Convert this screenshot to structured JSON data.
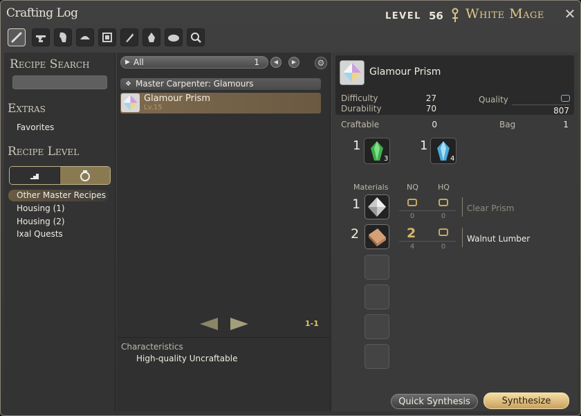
{
  "window": {
    "title": "Crafting Log",
    "level_label": "LEVEL",
    "level_value": "56",
    "job": "White Mage"
  },
  "toolbar": {
    "icons": [
      "carpenter-icon",
      "blacksmith-icon",
      "armorer-icon",
      "goldsmith-icon",
      "leatherworker-icon",
      "weaver-icon",
      "alchemist-icon",
      "culinarian-icon",
      "search-icon"
    ],
    "active_index": 0
  },
  "sidebar": {
    "recipe_search_heading": "Recipe Search",
    "extras_heading": "Extras",
    "favorites": "Favorites",
    "recipe_level_heading": "Recipe Level",
    "categories": [
      {
        "label": "Other Master Recipes",
        "selected": true
      },
      {
        "label": "Housing (1)",
        "selected": false
      },
      {
        "label": "Housing (2)",
        "selected": false
      },
      {
        "label": "Ixal Quests",
        "selected": false
      }
    ]
  },
  "list": {
    "filter_label": "All",
    "filter_count": "1",
    "group": "Master Carpenter: Glamours",
    "recipe": {
      "name": "Glamour Prism",
      "level": "Lv.15"
    },
    "page": "1-1",
    "characteristics_heading": "Characteristics",
    "characteristics_value": "High-quality Uncraftable"
  },
  "detail": {
    "name": "Glamour Prism",
    "difficulty_label": "Difficulty",
    "difficulty": "27",
    "durability_label": "Durability",
    "durability": "70",
    "quality_label": "Quality",
    "quality": "807",
    "craftable_label": "Craftable",
    "craftable": "0",
    "bag_label": "Bag",
    "bag": "1",
    "crystals": [
      {
        "qty": "1",
        "count": "3",
        "color": "#3fae4c"
      },
      {
        "qty": "1",
        "count": "4",
        "color": "#4aa8d8"
      }
    ],
    "materials_heading": "Materials",
    "nq_heading": "NQ",
    "hq_heading": "HQ",
    "materials": [
      {
        "qty": "1",
        "nq_need": "",
        "hq_need": "",
        "nq_have": "0",
        "hq_have": "0",
        "name": "Clear Prism",
        "name_color": "#8f8a7d"
      },
      {
        "qty": "2",
        "nq_need": "2",
        "hq_need": "",
        "nq_have": "4",
        "hq_have": "0",
        "name": "Walnut Lumber",
        "name_color": "#efece2"
      }
    ],
    "quick_synthesis": "Quick Synthesis",
    "synthesize": "Synthesize"
  }
}
